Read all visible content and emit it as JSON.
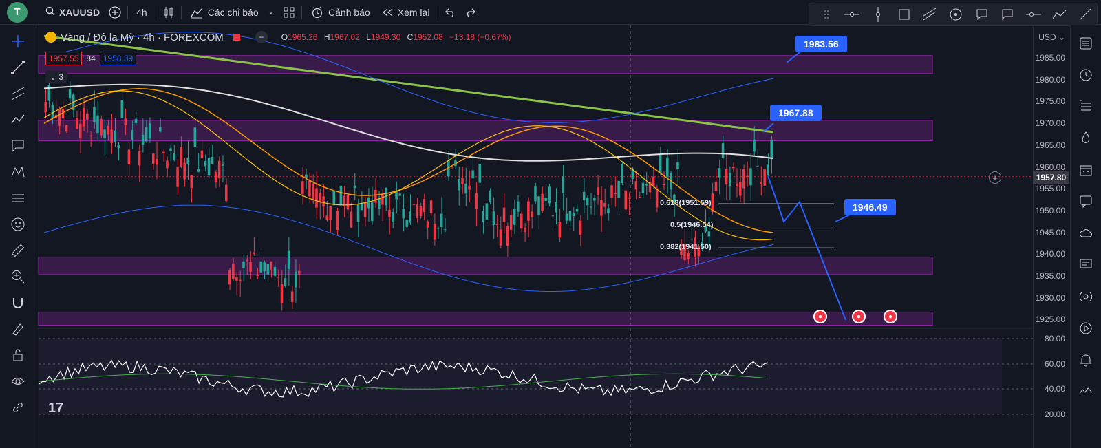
{
  "topbar": {
    "avatar": "T",
    "symbol": "XAUUSD",
    "interval": "4h",
    "indicators": "Các chỉ báo",
    "alerts": "Cảnh báo",
    "replay": "Xem lại"
  },
  "legend": {
    "title": "Vàng / Đô la Mỹ · 4h · FOREXCOM",
    "open_label": "O",
    "open": "1965.26",
    "high_label": "H",
    "high": "1967.02",
    "low_label": "L",
    "low": "1949.30",
    "close_label": "C",
    "close": "1952.08",
    "change": "−13.18 (−0.67%)",
    "bid": "1957.55",
    "spread": "84",
    "ask": "1958.39",
    "collapsed_count": "3"
  },
  "axis": {
    "currency": "USD",
    "current_price": "1957.80",
    "labels": [
      "1985.00",
      "1980.00",
      "1975.00",
      "1970.00",
      "1965.00",
      "1960.00",
      "1955.00",
      "1950.00",
      "1945.00",
      "1940.00",
      "1935.00",
      "1930.00",
      "1925.00"
    ],
    "rsi_labels": [
      "80.00",
      "60.00",
      "40.00",
      "20.00"
    ]
  },
  "callouts": {
    "target_high": "1983.56",
    "resistance": "1967.88",
    "target_low": "1946.49"
  },
  "fib": {
    "f618": "0.618(1951.59)",
    "f5": "0.5(1946.54)",
    "f382": "0.382(1941.50)"
  },
  "colors": {
    "bg": "#131722",
    "up": "#26a69a",
    "down": "#f23645",
    "zone": "#9c27b0",
    "accent": "#2962ff"
  },
  "icons": {
    "left": [
      "crosshair-icon",
      "trendline-icon",
      "parallel-channel-icon",
      "pitchfork-icon",
      "brush-icon",
      "pattern-icon",
      "measure-icon",
      "emoji-icon",
      "ruler-icon",
      "zoom-icon",
      "magnet-icon",
      "lock-draw-icon",
      "unlock-icon",
      "eye-icon",
      "link-icon"
    ],
    "right": [
      "watchlist-icon",
      "clock-icon",
      "news-list-icon",
      "fire-icon",
      "calendar-icon",
      "chat-icon",
      "cloud-icon",
      "comment-icon",
      "signal-icon",
      "play-icon",
      "bell-icon",
      "wave-icon"
    ]
  }
}
